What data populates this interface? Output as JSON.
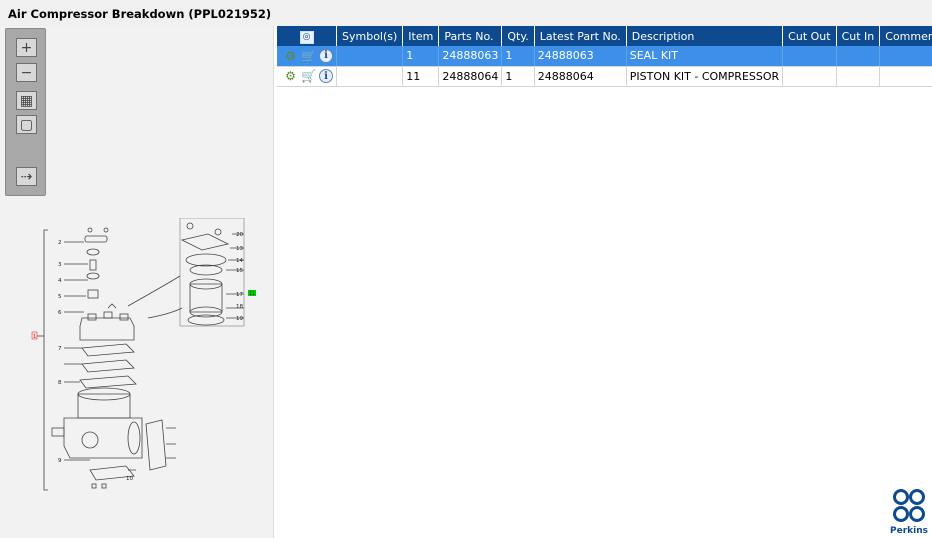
{
  "window": {
    "title": "Air Compressor Breakdown (PPL021952)"
  },
  "toolbar": {
    "buttons": [
      {
        "name": "zoom-in",
        "glyph": "+"
      },
      {
        "name": "zoom-out",
        "glyph": "−"
      },
      {
        "name": "fit-grid",
        "glyph": "▦"
      },
      {
        "name": "fit-page",
        "glyph": "▢"
      },
      {
        "name": "export",
        "glyph": "⇢"
      }
    ]
  },
  "diagram": {
    "callouts": [
      "2",
      "3",
      "4",
      "5",
      "6",
      "7",
      "8",
      "9",
      "10",
      "13",
      "14",
      "15",
      "17",
      "18",
      "19",
      "20"
    ],
    "highlight_label": "11",
    "marker_label": "1"
  },
  "table": {
    "columns": [
      "Symbol(s)",
      "Item",
      "Parts No.",
      "Qty.",
      "Latest Part No.",
      "Description",
      "Cut Out",
      "Cut In",
      "Comment"
    ],
    "rows": [
      {
        "item": "1",
        "parts_no": "24888063",
        "qty": "1",
        "latest": "24888063",
        "description": "SEAL KIT",
        "cut_out": "",
        "cut_in": "",
        "comment": "",
        "selected": true
      },
      {
        "item": "11",
        "parts_no": "24888064",
        "qty": "1",
        "latest": "24888064",
        "description": "PISTON KIT - COMPRESSOR",
        "cut_out": "",
        "cut_in": "",
        "comment": "",
        "selected": false
      }
    ]
  },
  "brand": {
    "name": "Perkins",
    "color": "#0e4a8f"
  },
  "colors": {
    "header": "#0e4a8f",
    "selected_row": "#3d8fe8",
    "highlight": "#00cc00",
    "marker": "#e04040"
  },
  "icons": [
    "view-diagram-icon",
    "gear-icon",
    "cart-icon",
    "info-icon"
  ]
}
